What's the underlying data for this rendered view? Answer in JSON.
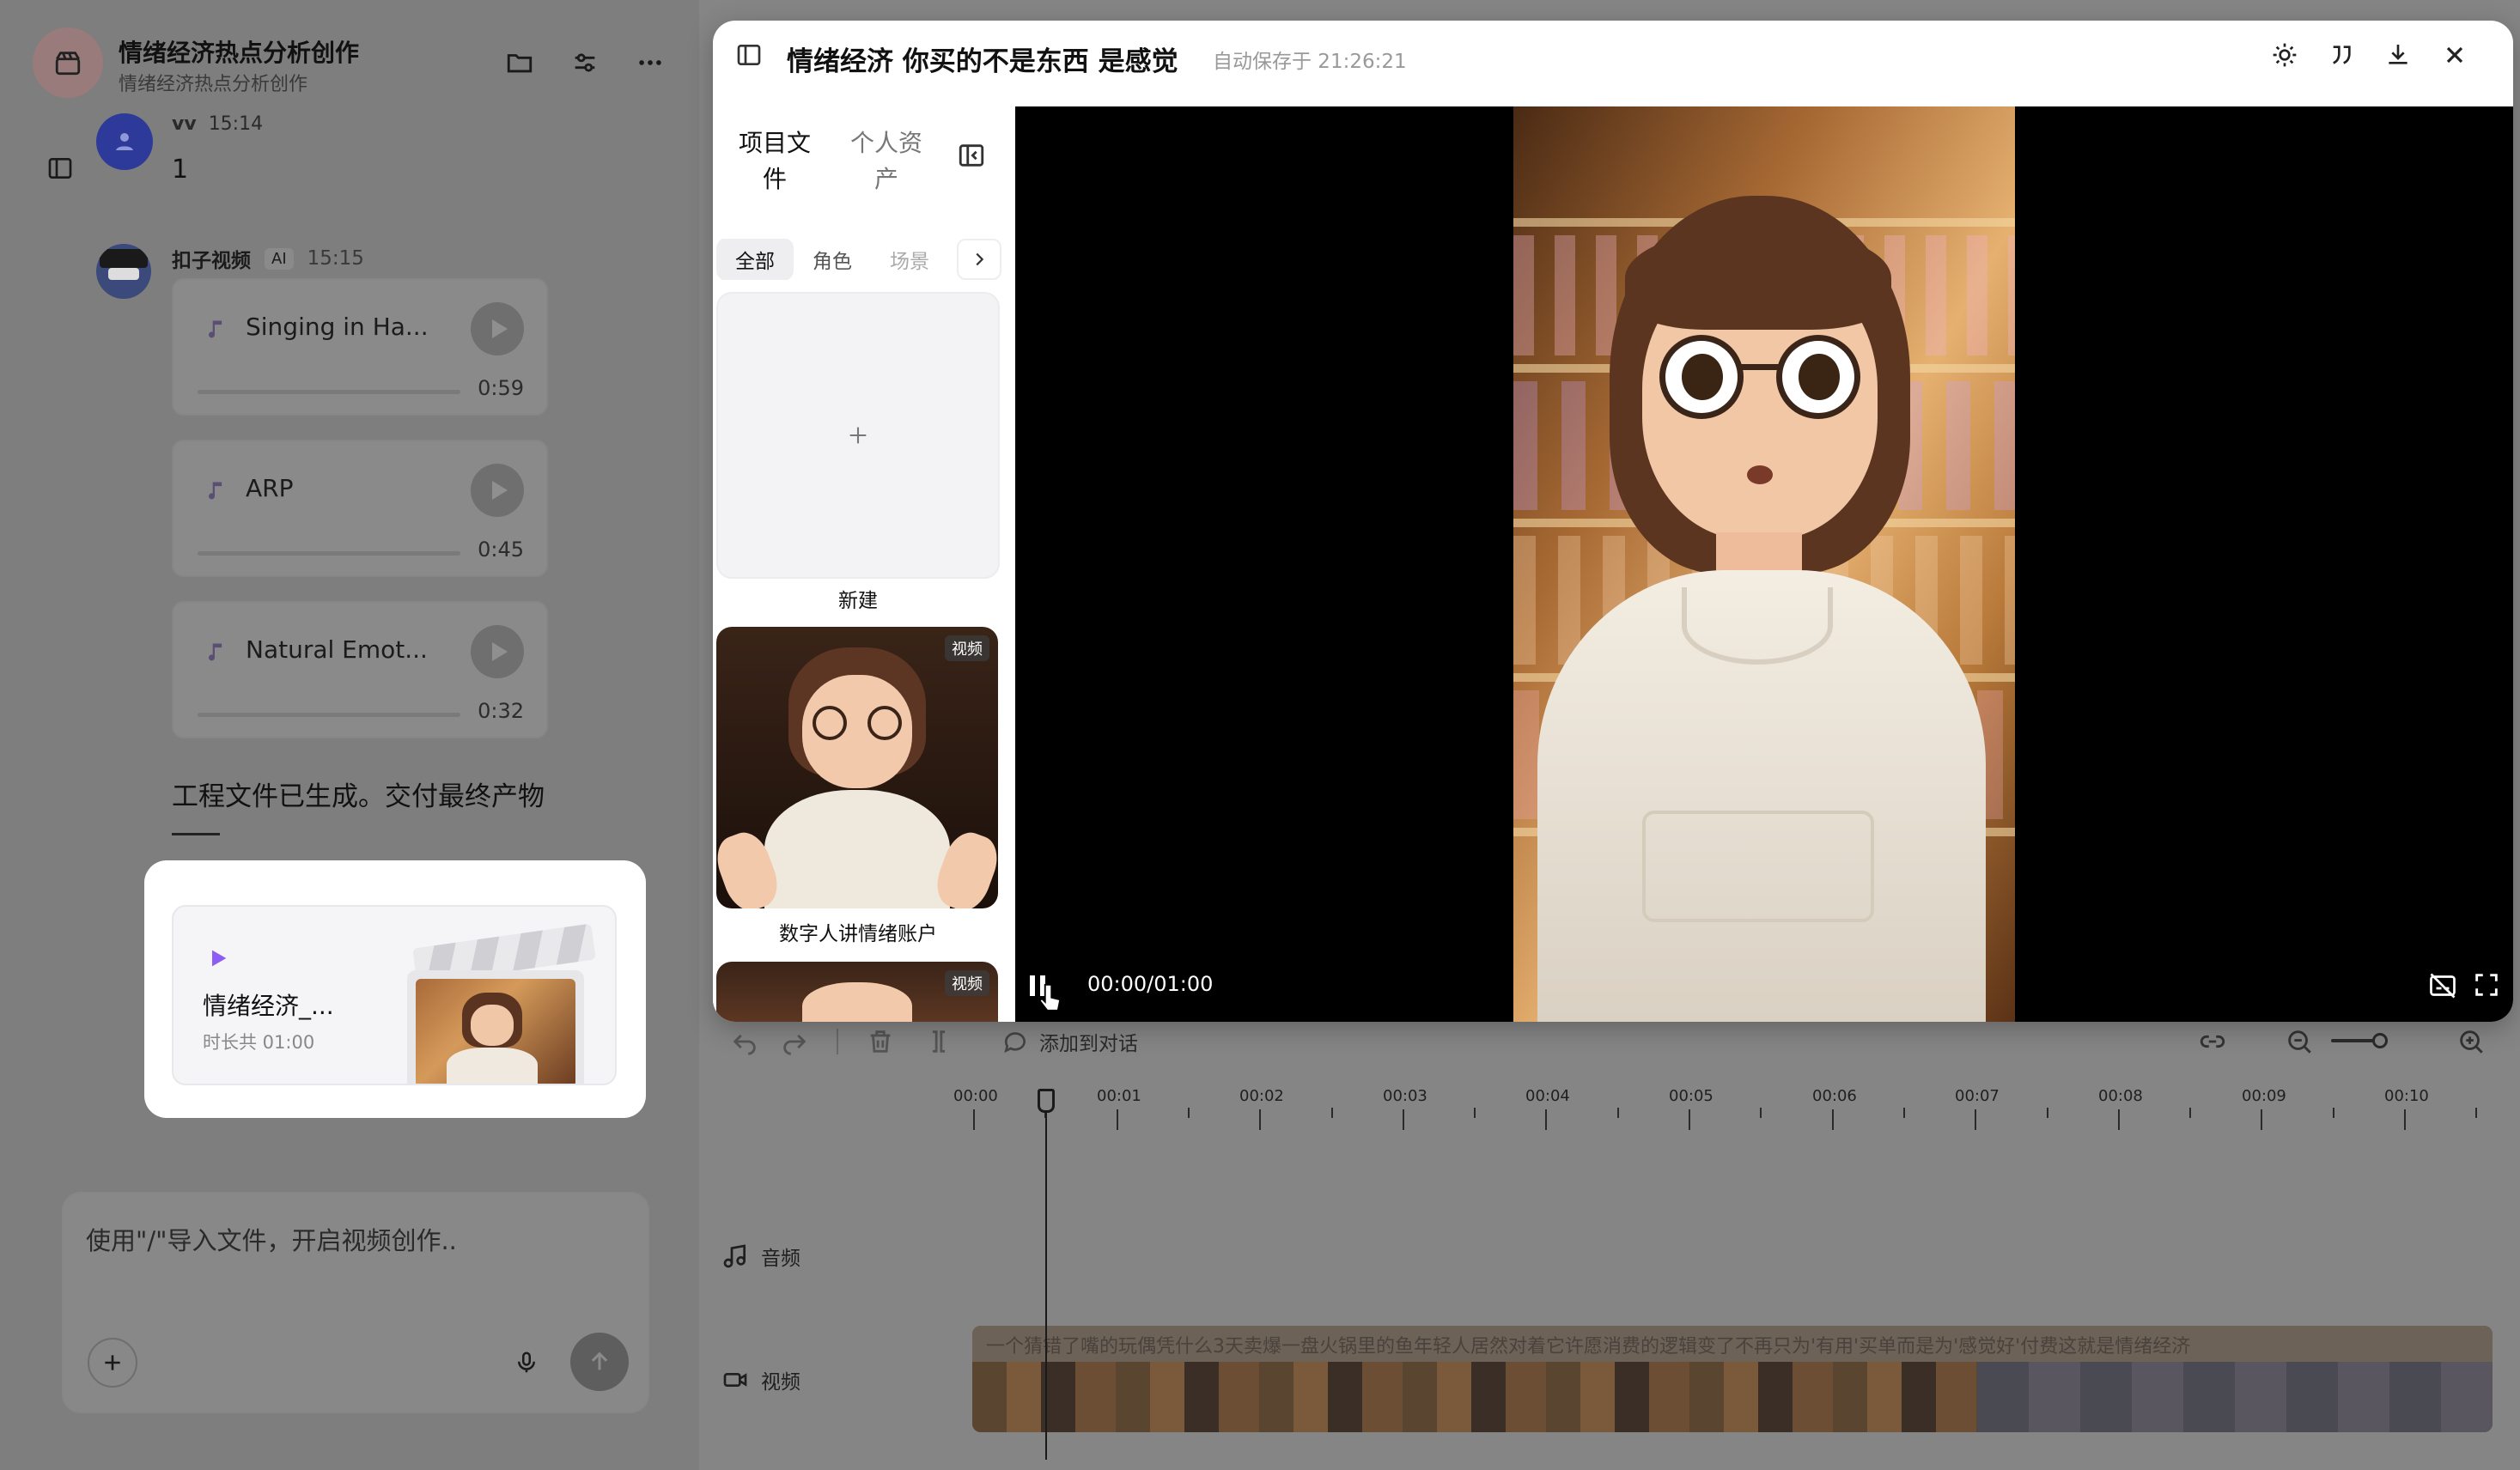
{
  "chat": {
    "project_title": "情绪经济热点分析创作",
    "project_subtitle": "情绪经济热点分析创作",
    "user_name": "vv",
    "user_time": "15:14",
    "user_message": "1",
    "bot_name": "扣子视频",
    "bot_badge": "AI",
    "bot_time": "15:15",
    "audio_tracks": [
      {
        "name": "Singing in Ha...",
        "duration": "0:59"
      },
      {
        "name": "ARP",
        "duration": "0:45"
      },
      {
        "name": "Natural Emot...",
        "duration": "0:32"
      }
    ],
    "bot_message": "工程文件已生成。交付最终产物",
    "deliverable": {
      "title": "情绪经济_...",
      "meta": "时长共 01:00"
    },
    "input_placeholder": "使用\"/\"导入文件，开启视频创作.."
  },
  "editor": {
    "title": "情绪经济 你买的不是东西 是感觉",
    "autosave": "自动保存于 21:26:21",
    "tabs": [
      "项目文件",
      "个人资产"
    ],
    "filters": [
      "全部",
      "角色",
      "场景"
    ],
    "new_label": "新建",
    "asset_badge": "视频",
    "asset_name": "数字人讲情绪账户",
    "time_display": "00:00/01:00",
    "add_to_chat": "添加到对话",
    "track_audio": "音频",
    "track_video": "视频",
    "subtitle_strip": "一个猜错了嘴的玩偶凭什么3天卖爆一盘火锅里的鱼年轻人居然对着它许愿消费的逻辑变了不再只为'有用'买单而是为'感觉好'付费这就是情绪经济",
    "ruler": [
      "00:00",
      "00:01",
      "00:02",
      "00:03",
      "00:04",
      "00:05",
      "00:06",
      "00:07",
      "00:08",
      "00:09",
      "00:10"
    ]
  },
  "colors": {
    "accent": "#8b5cf6",
    "panel": "#ffffff",
    "overlay": "#7e7e7e"
  }
}
